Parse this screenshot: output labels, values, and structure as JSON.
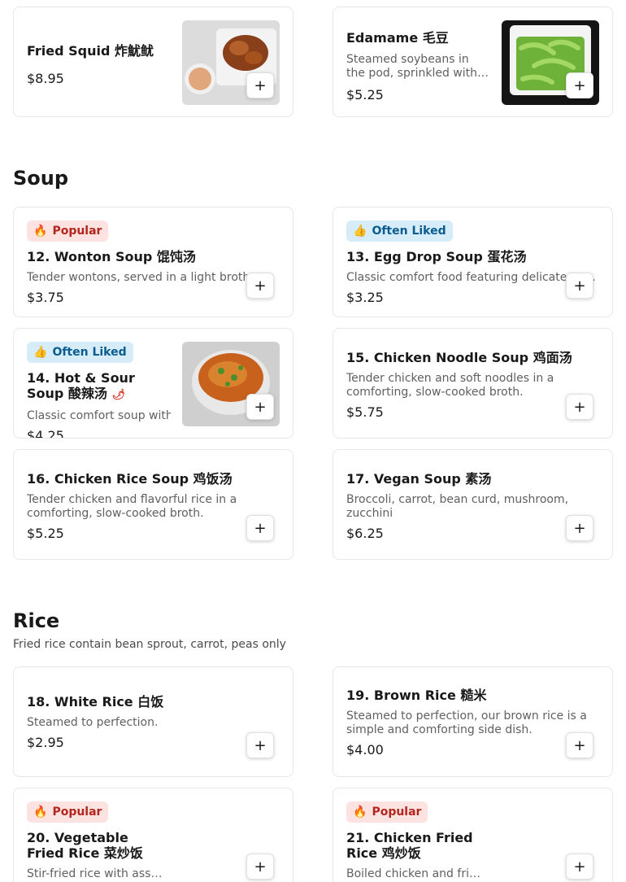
{
  "top_items": [
    {
      "name": "Fried Squid 炸魷鱿",
      "price": "$8.95"
    },
    {
      "name": "Edamame 毛豆",
      "description": "Steamed soybeans in the pod, sprinkled with sea salt.",
      "price": "$5.25"
    }
  ],
  "soup": {
    "title": "Soup",
    "items": [
      {
        "badge": "Popular",
        "name": "12. Wonton Soup 馄饨汤",
        "description": "Tender wontons, served in a light broth.",
        "price": "$3.75"
      },
      {
        "badge": "Often Liked",
        "name": "13. Egg Drop Soup 蛋花汤",
        "description": "Classic comfort food featuring delicate egg.",
        "price": "$3.25"
      },
      {
        "badge": "Often Liked",
        "name": "14. Hot & Sour Soup 酸辣汤",
        "description": "Classic comfort soup with a spicy kick.",
        "price": "$4.25"
      },
      {
        "name": "15. Chicken Noodle Soup 鸡面汤",
        "description": "Tender chicken and soft noodles in a comforting, slow-cooked broth.",
        "price": "$5.75"
      },
      {
        "name": "16. Chicken Rice Soup 鸡饭汤",
        "description": "Tender chicken and flavorful rice in a comforting, slow-cooked broth.",
        "price": "$5.25"
      },
      {
        "name": "17. Vegan Soup 素汤",
        "description": "Broccoli, carrot, bean curd, mushroom, zucchini",
        "price": "$6.25"
      }
    ]
  },
  "rice": {
    "title": "Rice",
    "subtitle": "Fried rice contain bean sprout, carrot, peas only",
    "items": [
      {
        "name": "18. White Rice 白饭",
        "description": "Steamed to perfection.",
        "price": "$2.95"
      },
      {
        "name": "19. Brown Rice 糙米",
        "description": "Steamed to perfection, our brown rice is a simple and comforting side dish.",
        "price": "$4.00"
      },
      {
        "badge": "Popular",
        "name": "20. Vegetable Fried Rice 菜炒饭",
        "description": "Stir-fried rice with assorted vegetables."
      },
      {
        "badge": "Popular",
        "name": "21. Chicken Fried Rice 鸡炒饭",
        "description": "Boiled chicken and fried rice."
      }
    ]
  },
  "ui": {
    "add_label": "+",
    "popular_glyph": "🔥",
    "liked_glyph": "👍",
    "spicy_glyph": "🌶"
  },
  "colors": {
    "popular_bg": "#fce3e1",
    "popular_text": "#b3261e",
    "liked_bg": "#d6ecf8",
    "liked_text": "#0a5c8f",
    "spicy": "#d83a2e"
  }
}
